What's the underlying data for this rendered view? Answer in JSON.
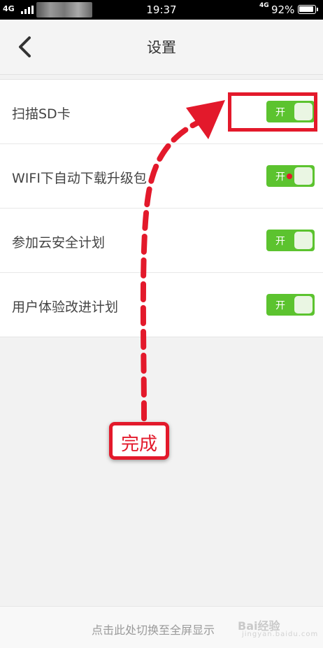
{
  "statusbar": {
    "network_left": "4G",
    "time": "19:37",
    "network_right": "4G",
    "battery": "92%"
  },
  "header": {
    "title": "设置"
  },
  "settings": [
    {
      "label": "扫描SD卡",
      "toggle_text": "开",
      "state": "on"
    },
    {
      "label": "WIFI下自动下载升级包",
      "toggle_text": "开",
      "state": "on"
    },
    {
      "label": "参加云安全计划",
      "toggle_text": "开",
      "state": "on"
    },
    {
      "label": "用户体验改进计划",
      "toggle_text": "开",
      "state": "on"
    }
  ],
  "annotation": {
    "done_label": "完成",
    "color": "#e3192b"
  },
  "footer": {
    "link": "点击此处切换至全屏显示",
    "watermark": "Bai经验",
    "watermark_sub": "jingyan.baidu.com"
  },
  "colors": {
    "toggle_on": "#5cc32f",
    "accent_red": "#e3192b"
  }
}
